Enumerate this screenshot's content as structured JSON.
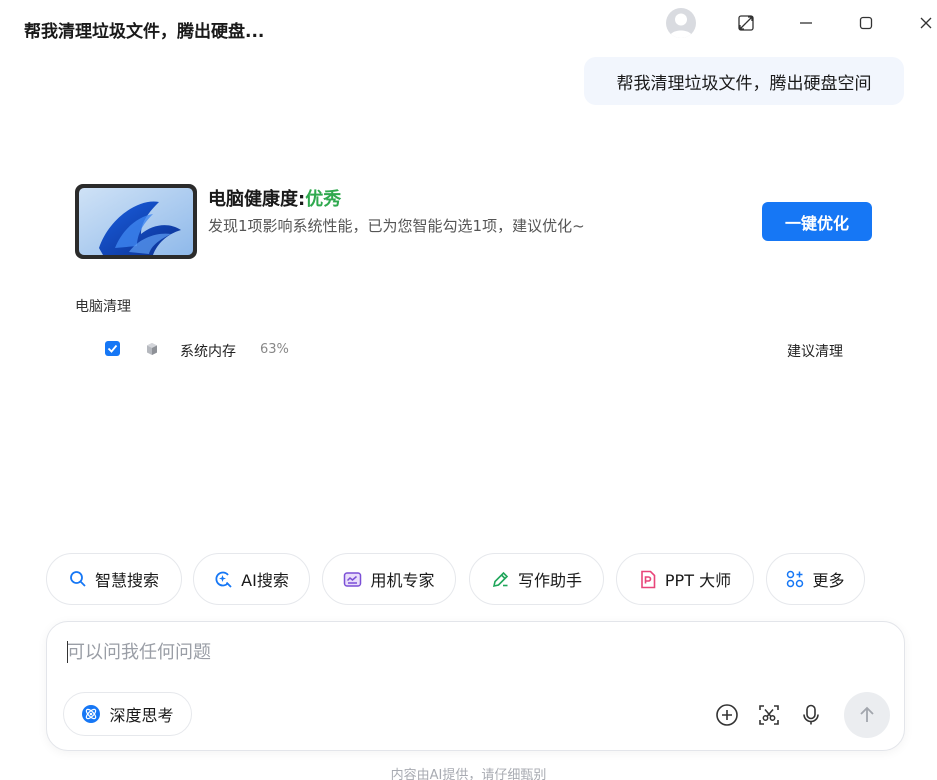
{
  "window": {
    "title": "帮我清理垃圾文件，腾出硬盘...",
    "icons": [
      "avatar",
      "expand-icon",
      "minimize-icon",
      "maximize-icon",
      "close-icon"
    ]
  },
  "chat": {
    "user_message": "帮我清理垃圾文件，腾出硬盘空间"
  },
  "health": {
    "title_label": "电脑健康度:",
    "status": "优秀",
    "status_color": "#2fa94e",
    "description": "发现1项影响系统性能，已为您智能勾选1项，建议优化~",
    "optimize_button": "一键优化",
    "accent_color": "#1677f5"
  },
  "cleanup": {
    "section_label": "电脑清理",
    "items": [
      {
        "checked": true,
        "name": "系统内存",
        "percent": "63%",
        "action": "建议清理"
      }
    ]
  },
  "tools": [
    {
      "label": "智慧搜索",
      "icon": "search-icon"
    },
    {
      "label": "AI搜索",
      "icon": "ai-search-icon"
    },
    {
      "label": "用机专家",
      "icon": "keyboard-icon"
    },
    {
      "label": "写作助手",
      "icon": "pen-icon"
    },
    {
      "label": "PPT 大师",
      "icon": "ppt-icon"
    },
    {
      "label": "更多",
      "icon": "grid-icon"
    }
  ],
  "composer": {
    "placeholder": "可以问我任何问题",
    "value": "",
    "deep_think_label": "深度思考"
  },
  "footer": {
    "note": "内容由AI提供，请仔细甄别"
  }
}
